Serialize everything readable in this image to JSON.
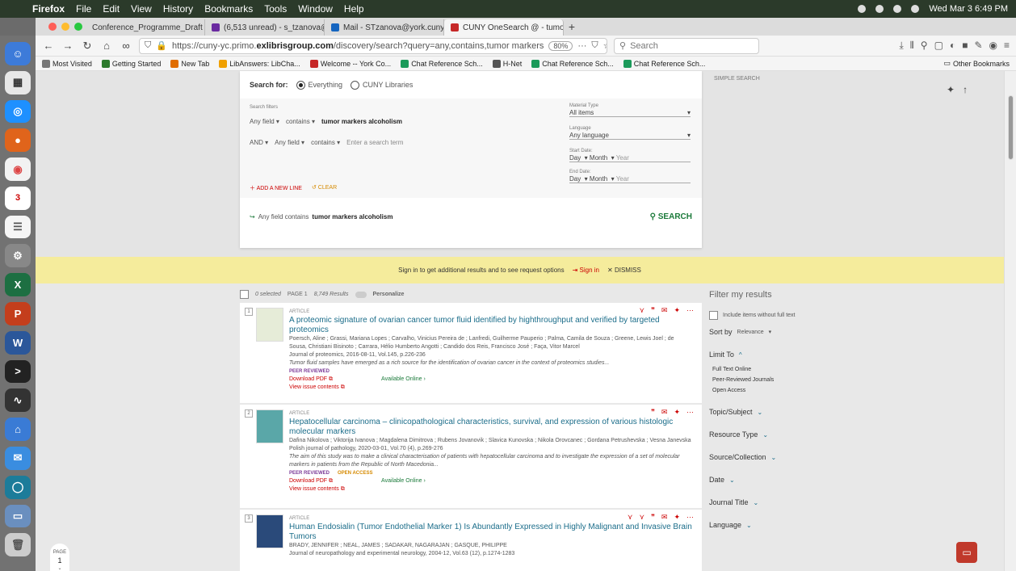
{
  "menubar": {
    "app": "Firefox",
    "items": [
      "File",
      "Edit",
      "View",
      "History",
      "Bookmarks",
      "Tools",
      "Window",
      "Help"
    ],
    "clock": "Wed Mar 3  6:49 PM"
  },
  "tabs": [
    {
      "label": "Conference_Programme_Draft",
      "color": "#e0a33b"
    },
    {
      "label": "(6,513 unread) - s_tzanova@y",
      "color": "#6a2aa0"
    },
    {
      "label": "Mail - STzanova@york.cuny.edu",
      "color": "#1565c0"
    },
    {
      "label": "CUNY OneSearch @ - tumor m",
      "color": "#c62828"
    }
  ],
  "nav": {
    "url_prefix": "https://cuny-yc.primo.",
    "url_domain": "exlibrisgroup.com",
    "url_rest": "/discovery/search?query=any,contains,tumor markers",
    "zoom": "80%",
    "more": "···",
    "search_placeholder": "Search"
  },
  "bookmarks": [
    {
      "label": "Most Visited",
      "color": "#777"
    },
    {
      "label": "Getting Started",
      "color": "#2d7a2d"
    },
    {
      "label": "New Tab",
      "color": "#e06d00"
    },
    {
      "label": "LibAnswers: LibCha...",
      "color": "#f0a000"
    },
    {
      "label": "Welcome -- York Co...",
      "color": "#c62828"
    },
    {
      "label": "Chat Reference Sch...",
      "color": "#1b9a5a"
    },
    {
      "label": "H-Net",
      "color": "#555"
    },
    {
      "label": "Chat Reference Sch...",
      "color": "#1b9a5a"
    },
    {
      "label": "Chat Reference Sch...",
      "color": "#1b9a5a"
    }
  ],
  "other_bookmarks": "Other Bookmarks",
  "search": {
    "search_for": "Search for:",
    "opt1": "Everything",
    "opt2": "CUNY Libraries",
    "filters_label": "Search filters",
    "row1_field": "Any field",
    "row1_op": "contains",
    "row1_value": "tumor markers alcoholism",
    "row2_bool": "AND",
    "row2_field": "Any field",
    "row2_op": "contains",
    "row2_placeholder": "Enter a search term",
    "material_label": "Material Type",
    "material_value": "All items",
    "language_label": "Language",
    "language_value": "Any language",
    "start_label": "Start Date:",
    "end_label": "End Date:",
    "day": "Day",
    "month": "Month",
    "year": "Year",
    "add_line": "ADD A NEW LINE",
    "clear": "CLEAR",
    "query_prefix": "Any field contains",
    "query_value": "tumor markers alcoholism",
    "search_btn": "SEARCH",
    "simple": "SIMPLE SEARCH"
  },
  "signin": {
    "text": "Sign in to get additional results and to see request options",
    "signin": "Sign in",
    "dismiss": "DISMISS"
  },
  "resbar": {
    "selected": "0 selected",
    "page": "PAGE 1",
    "count": "8,749 Results",
    "personalize": "Personalize"
  },
  "results": [
    {
      "num": "1",
      "type": "ARTICLE",
      "title": "A proteomic signature of ovarian cancer tumor fluid identified by highthroughput and verified by targeted proteomics",
      "authors": "Poersch, Aline ; Grassi, Mariana Lopes ; Carvalho, Vinicius Pereira de ; Lanfredi, Guilherme Pauperio ; Palma, Camila de Souza ; Greene, Lewis Joel ; de Sousa, Christiani Bisinoto ; Carrara, Hélio Humberto Angotti ; Candido dos Reis, Francisco José ; Faça, Vitor Marcel",
      "source": "Journal of proteomics, 2016-08-11, Vol.145, p.226-236",
      "abstract": "Tumor fluid samples have emerged as a rich source for the identification of ovarian cancer in the context of proteomics studies...",
      "badge": "PEER REVIEWED",
      "oa": "",
      "pdf": "Download PDF",
      "online": "Available Online",
      "issue": "View issue contents"
    },
    {
      "num": "2",
      "type": "ARTICLE",
      "title": "Hepatocellular carcinoma – clinicopathological characteristics, survival, and expression of various histologic molecular markers",
      "authors": "Dafina Nikolova ; Viktorija Ivanova ; Magdalena Dimitrova ; Rubens Jovanovik ; Slavica Kunovska ; Nikola Orovcanec ; Gordana Petrushevska ; Vesna Janevska",
      "source": "Polish journal of pathology, 2020-03-01, Vol.70 (4), p.269-276",
      "abstract": "The aim of this study was to make a clinical characterisation of patients with hepatocellular carcinoma and to investigate the expression of a set of molecular markers in patients from the Republic of North Macedonia...",
      "badge": "PEER REVIEWED",
      "oa": "OPEN ACCESS",
      "pdf": "Download PDF",
      "online": "Available Online",
      "issue": "View issue contents"
    },
    {
      "num": "3",
      "type": "ARTICLE",
      "title": "Human Endosialin (Tumor Endothelial Marker 1) Is Abundantly Expressed in Highly Malignant and Invasive Brain Tumors",
      "authors": "BRADY, JENNIFER ; NEAL, JAMES ; SADAKAR, NAGARAJAN ; GASQUE, PHILIPPE",
      "source": "Journal of neuropathology and experimental neurology, 2004-12, Vol.63 (12), p.1274-1283"
    }
  ],
  "facets": {
    "title": "Filter my results",
    "include": "Include items without full text",
    "sort_label": "Sort by",
    "sort_value": "Relevance",
    "limit": "Limit To",
    "limit_items": [
      "Full Text Online",
      "Peer-Reviewed Journals",
      "Open Access"
    ],
    "groups": [
      "Topic/Subject",
      "Resource Type",
      "Source/Collection",
      "Date",
      "Journal Title",
      "Language"
    ]
  },
  "pager": {
    "label": "PAGE",
    "num": "1"
  }
}
